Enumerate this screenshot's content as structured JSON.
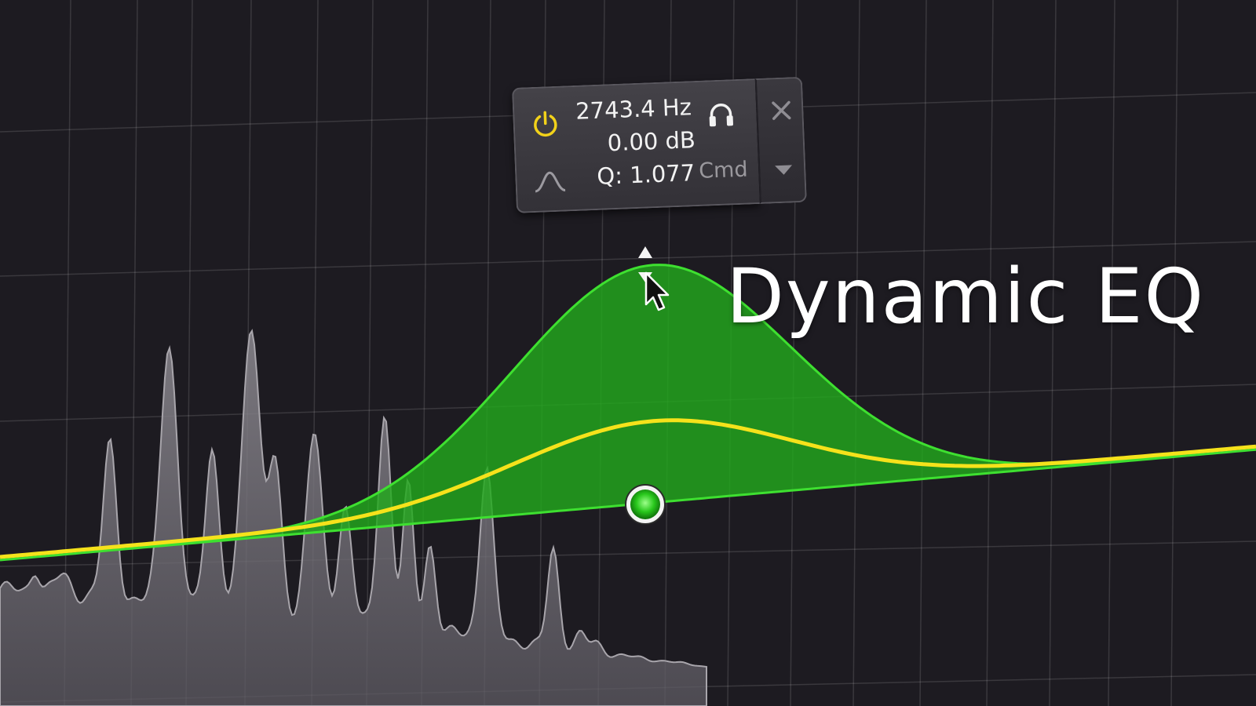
{
  "band_panel": {
    "frequency": "2743.4 Hz",
    "gain": "0.00 dB",
    "q": "Q: 1.077",
    "modifier_hint": "Cmd",
    "power_icon": "power-icon",
    "shape_icon": "bell-shape-icon",
    "solo_icon": "headphones-icon",
    "close_icon": "close-icon",
    "menu_icon": "dropdown-icon"
  },
  "overlay_title": "Dynamic EQ",
  "colors": {
    "background": "#1d1b21",
    "band_fill": "#22a81c",
    "band_outline": "#3ee030",
    "dynamic_curve": "#f5e21b",
    "spectrum": "#8a878e",
    "power_accent": "#f2d21a"
  }
}
